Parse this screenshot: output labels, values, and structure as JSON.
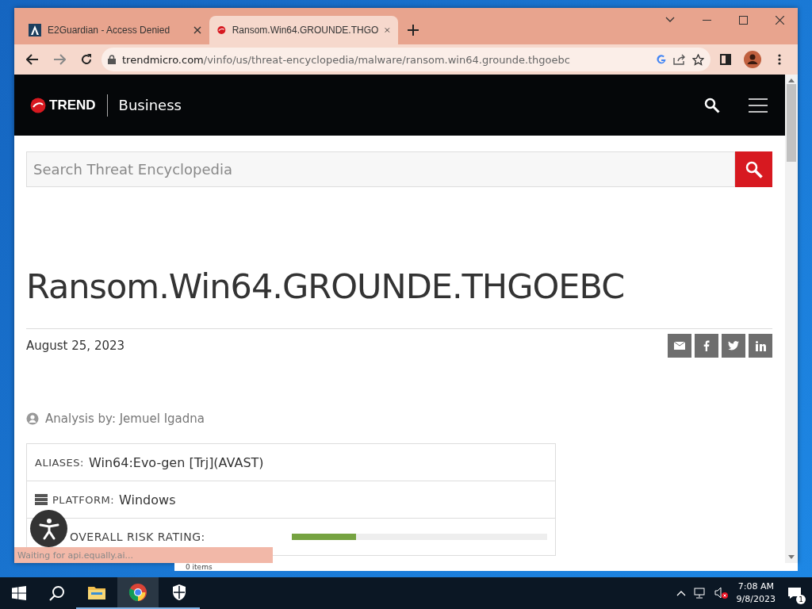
{
  "browser": {
    "tabs": [
      {
        "title": "E2Guardian - Access Denied",
        "selected": false,
        "kind": "e2"
      },
      {
        "title": "Ransom.Win64.GROUNDE.THGO",
        "selected": true,
        "kind": "trend"
      }
    ],
    "url": {
      "domain": "trendmicro.com",
      "path": "/vinfo/us/threat-encyclopedia/malware/ransom.win64.grounde.thgoebc"
    },
    "status": "Waiting for api.equally.ai..."
  },
  "page": {
    "header": {
      "logo": "TREND",
      "section": "Business"
    },
    "search": {
      "placeholder": "Search Threat Encyclopedia"
    },
    "title": "Ransom.Win64.GROUNDE.THGOEBC",
    "date": "August 25, 2023",
    "share": [
      {
        "kind": "email"
      },
      {
        "kind": "facebook"
      },
      {
        "kind": "twitter"
      },
      {
        "kind": "linkedin"
      }
    ],
    "analysis": "Analysis by: Jemuel Igadna",
    "details": [
      {
        "kind": "text",
        "label": "ALIASES:",
        "value": "Win64:Evo-gen [Trj](AVAST)"
      },
      {
        "kind": "text",
        "label": "PLATFORM:",
        "value": "Windows"
      },
      {
        "kind": "meter",
        "label": "OVERALL RISK RATING:",
        "level": 0.25
      }
    ]
  },
  "background_window": {
    "status": "0 items"
  },
  "taskbar": {
    "apps": [
      {
        "kind": "explorer",
        "selected": false
      },
      {
        "kind": "chrome",
        "selected": true
      },
      {
        "kind": "shield",
        "selected": false
      }
    ],
    "time": "7:08 AM",
    "date": "9/8/2023",
    "notifications": "1"
  }
}
